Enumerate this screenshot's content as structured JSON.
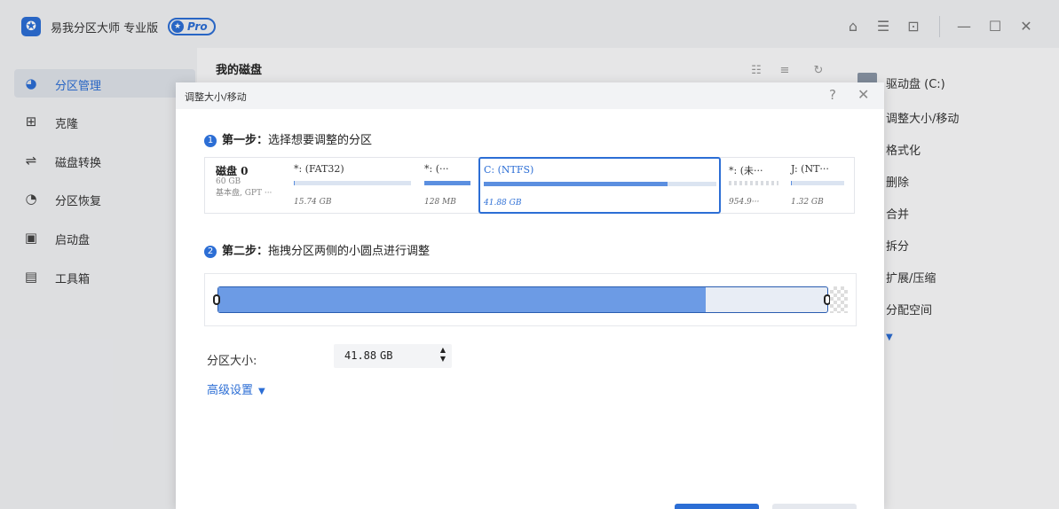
{
  "app": {
    "title": "易我分区大师 专业版",
    "badge": "Pro"
  },
  "window_controls": [
    "shirt-icon",
    "notes-icon",
    "dropdown-icon",
    "minimize-icon",
    "maximize-icon",
    "close-icon"
  ],
  "sidebar": {
    "items": [
      {
        "label": "分区管理",
        "icon": "pie-icon",
        "active": true
      },
      {
        "label": "克隆",
        "icon": "clone-icon"
      },
      {
        "label": "磁盘转换",
        "icon": "convert-icon"
      },
      {
        "label": "分区恢复",
        "icon": "recover-icon"
      },
      {
        "label": "启动盘",
        "icon": "boot-icon"
      },
      {
        "label": "工具箱",
        "icon": "toolbox-icon"
      }
    ]
  },
  "main": {
    "title": "我的磁盘"
  },
  "right_panel": {
    "drive": "驱动盘 (C:)",
    "actions": [
      "调整大小/移动",
      "格式化",
      "删除",
      "合并",
      "拆分",
      "扩展/压缩",
      "分配空间"
    ]
  },
  "dialog": {
    "title": "调整大小/移动",
    "step1": {
      "num": "1",
      "label": "第一步：",
      "text": "选择想要调整的分区"
    },
    "step2": {
      "num": "2",
      "label": "第二步：",
      "text": "拖拽分区两侧的小圆点进行调整"
    },
    "disk": {
      "name": "磁盘 0",
      "size": "60 GB",
      "type": "基本盘, GPT ···"
    },
    "partitions": [
      {
        "label": "*: (FAT32)",
        "size": "15.74 GB",
        "used": 0.01
      },
      {
        "label": "*: (···",
        "size": "128 MB",
        "used": 1.0
      },
      {
        "label": "C: (NTFS)",
        "size": "41.88 GB",
        "used": 0.79,
        "selected": true
      },
      {
        "label": "*: (未···",
        "size": "954.9···",
        "used": 0,
        "unallocated": true
      },
      {
        "label": "J: (NT···",
        "size": "1.32 GB",
        "used": 0.02
      }
    ],
    "resize_fill": 0.8,
    "size_label": "分区大小:",
    "size_value": "41.88",
    "size_unit": "GB",
    "advanced": "高级设置"
  }
}
